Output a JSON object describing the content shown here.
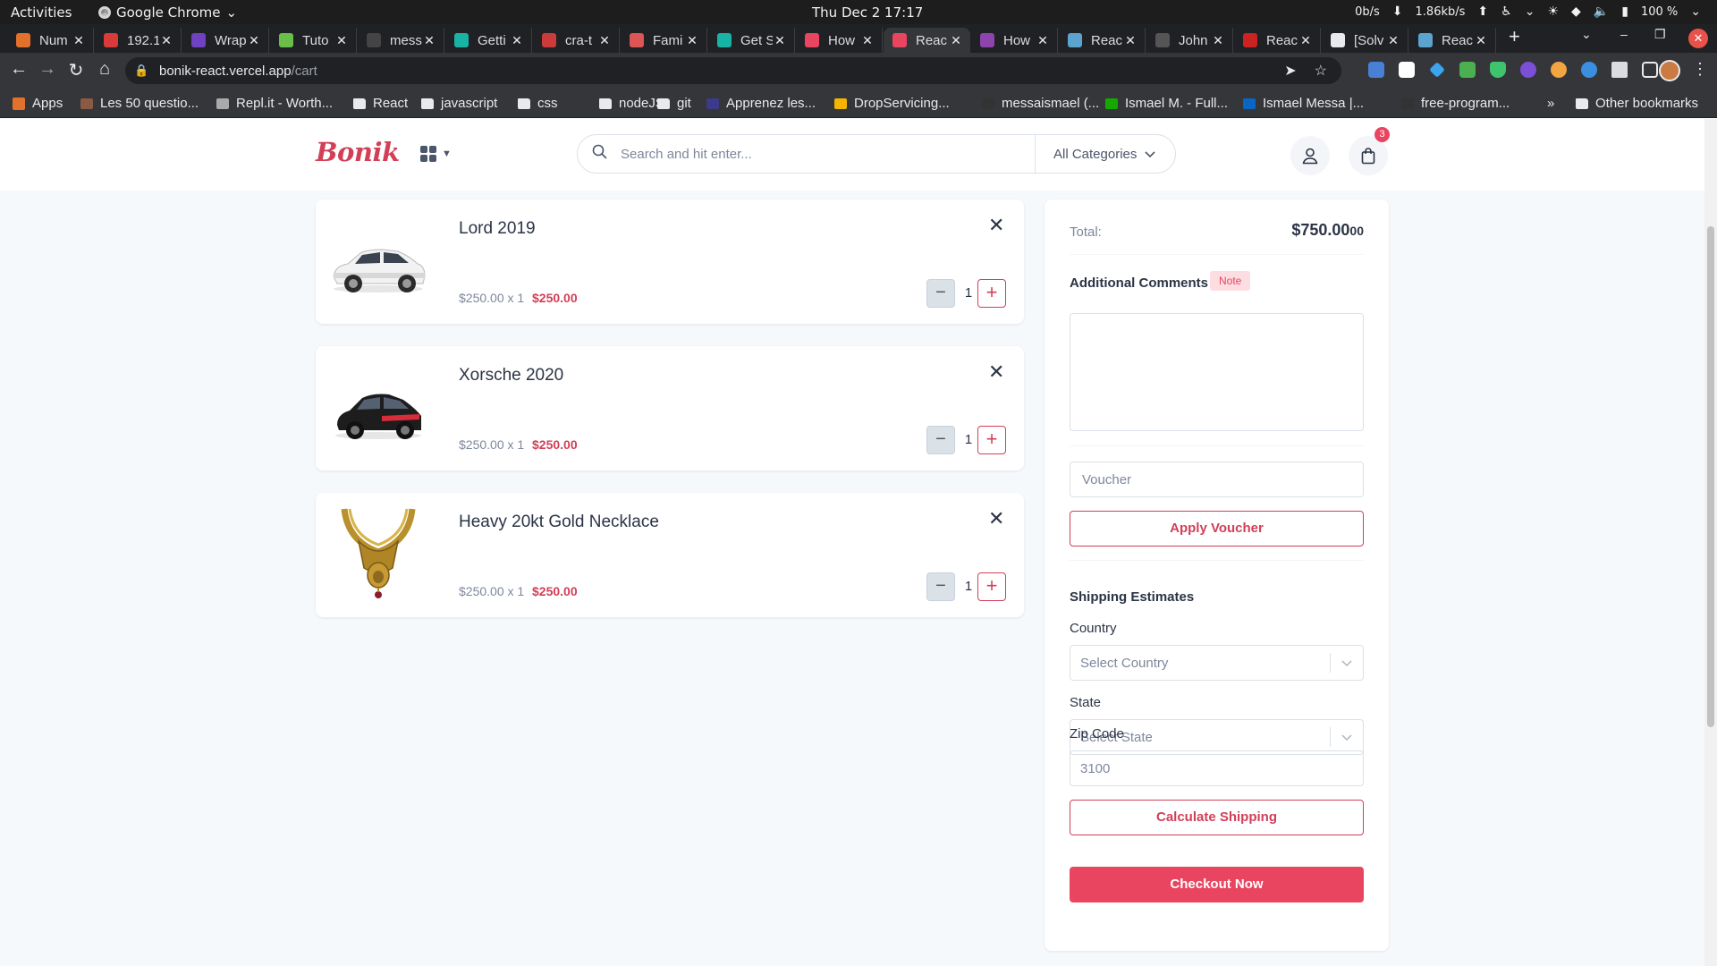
{
  "os": {
    "activities": "Activities",
    "app_name": "Google Chrome",
    "clock": "Thu Dec 2  17:17",
    "net_down": "0b/s",
    "net_up": "1.86kb/s",
    "battery": "100 %"
  },
  "tabs": [
    {
      "label": "Num",
      "color": "#e2722b"
    },
    {
      "label": "192.1",
      "color": "#d93a3a"
    },
    {
      "label": "Wrap",
      "color": "#6f42c1"
    },
    {
      "label": "Tuto",
      "color": "#6abf4b"
    },
    {
      "label": "mess",
      "color": "#444444"
    },
    {
      "label": "Getti",
      "color": "#19b3a6"
    },
    {
      "label": "cra-t",
      "color": "#cc3b3b"
    },
    {
      "label": "Fami",
      "color": "#dd5555"
    },
    {
      "label": "Get S",
      "color": "#19b3a6"
    },
    {
      "label": "How",
      "color": "#e94560"
    },
    {
      "label": "Reac",
      "color": "#e94560"
    },
    {
      "label": "How",
      "color": "#8e44ad"
    },
    {
      "label": "Reac",
      "color": "#5ba4cf"
    },
    {
      "label": "John",
      "color": "#555555"
    },
    {
      "label": "Reac",
      "color": "#cc2222"
    },
    {
      "label": "[Solv",
      "color": "#e8eaed"
    },
    {
      "label": "Reac",
      "color": "#5ba4cf"
    }
  ],
  "browser": {
    "url_host": "bonik-react.vercel.app",
    "url_path": "/cart"
  },
  "bookmarks": [
    {
      "label": "Apps",
      "color": "#e2722b"
    },
    {
      "label": "Les 50 questio...",
      "color": "#8a5a44"
    },
    {
      "label": "Repl.it - Worth...",
      "color": "#aaaaaa"
    },
    {
      "label": "React",
      "color": "#e8eaed"
    },
    {
      "label": "javascript",
      "color": "#e8eaed"
    },
    {
      "label": "css",
      "color": "#e8eaed"
    },
    {
      "label": "nodeJS",
      "color": "#e8eaed"
    },
    {
      "label": "git",
      "color": "#e8eaed"
    },
    {
      "label": "Apprenez les...",
      "color": "#3b3b8a"
    },
    {
      "label": "DropServicing...",
      "color": "#f4b400"
    },
    {
      "label": "messaismael (...",
      "color": "#333333"
    },
    {
      "label": "Ismael M. - Full...",
      "color": "#14a800"
    },
    {
      "label": "Ismael Messa |...",
      "color": "#0a66c2"
    },
    {
      "label": "free-program...",
      "color": "#333333"
    },
    {
      "label": "Other bookmarks",
      "color": "#e8eaed"
    }
  ],
  "header": {
    "logo": "Bonik",
    "search_placeholder": "Search and hit enter...",
    "category_label": "All Categories",
    "cart_count": "3"
  },
  "cart_items": [
    {
      "name": "Lord 2019",
      "unit_line": "$250.00 x 1",
      "line_total": "$250.00",
      "qty": "1"
    },
    {
      "name": "Xorsche 2020",
      "unit_line": "$250.00 x 1",
      "line_total": "$250.00",
      "qty": "1"
    },
    {
      "name": "Heavy 20kt Gold Necklace",
      "unit_line": "$250.00 x 1",
      "line_total": "$250.00",
      "qty": "1"
    }
  ],
  "summary": {
    "total_label": "Total:",
    "total_value": "$750.00",
    "total_cents": "00",
    "comments_label": "Additional Comments",
    "note_badge": "Note",
    "voucher_placeholder": "Voucher",
    "apply_voucher": "Apply Voucher",
    "shipping_heading": "Shipping Estimates",
    "country_label": "Country",
    "country_placeholder": "Select Country",
    "state_label": "State",
    "state_placeholder": "Select State",
    "zip_label": "Zip Code",
    "zip_value": "3100",
    "calculate_shipping": "Calculate Shipping",
    "checkout": "Checkout Now"
  },
  "colors": {
    "brand": "#d23f57",
    "accent": "#e94560",
    "text": "#2b3445",
    "muted": "#7d879c",
    "page_bg": "#f6f9fc"
  }
}
